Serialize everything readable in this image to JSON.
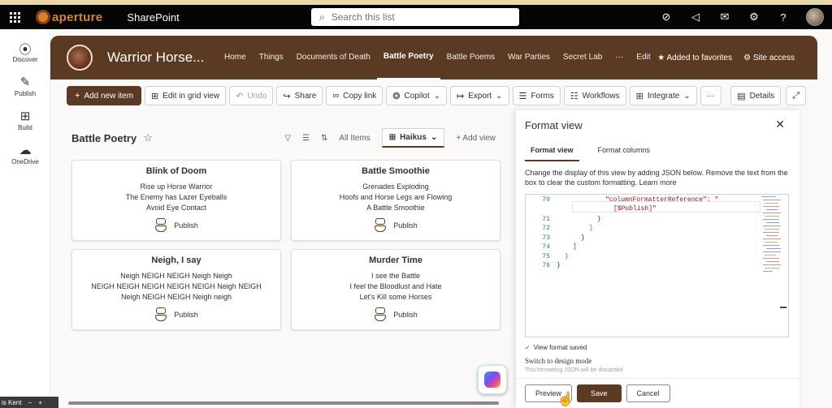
{
  "suite": {
    "brand": "aperture",
    "app_name": "SharePoint",
    "search_placeholder": "Search this list"
  },
  "appbar": {
    "items": [
      {
        "label": "Discover",
        "icon": "compass-icon"
      },
      {
        "label": "Publish",
        "icon": "pen-icon"
      },
      {
        "label": "Build",
        "icon": "grid-icon"
      },
      {
        "label": "OneDrive",
        "icon": "cloud-icon"
      }
    ]
  },
  "site": {
    "title": "Warrior Horse...",
    "nav": [
      "Home",
      "Things",
      "Documents of Death",
      "Battle Poetry",
      "Battle Poems",
      "War Parties",
      "Secret Lab",
      "···",
      "Edit"
    ],
    "active_nav": "Battle Poetry",
    "favorites_label": "Added to favorites",
    "site_access_label": "Site access"
  },
  "commands": {
    "add_new": "Add new item",
    "edit_grid": "Edit in grid view",
    "undo": "Undo",
    "share": "Share",
    "copy_link": "Copy link",
    "copilot": "Copilot",
    "export": "Export",
    "forms": "Forms",
    "workflows": "Workflows",
    "integrate": "Integrate",
    "more": "···",
    "details": "Details"
  },
  "list": {
    "title": "Battle Poetry",
    "view_all": "All Items",
    "current_view": "Haikus",
    "add_view": "Add view",
    "publish_label": "Publish",
    "tiles": [
      {
        "title": "Blink of Doom",
        "lines": [
          "Rise up Horse Warrior",
          "The Enemy has Lazer Eyeballs",
          "Avoid Eye Contact"
        ]
      },
      {
        "title": "Battle Smoothie",
        "lines": [
          "Grenades Exploding",
          "Hoofs and Horse Legs are Flowing",
          "A Battle Smoothie"
        ]
      },
      {
        "title": "Neigh, I say",
        "lines": [
          "Neigh NEIGH NEIGH Neigh Neigh",
          "NEIGH NEIGH NEIGH NEIGH NEIGH Neigh NEIGH",
          "Neigh NEIGH NEIGH Neigh neigh"
        ]
      },
      {
        "title": "Murder Time",
        "lines": [
          "I see the Battle",
          "I feel the Bloodlust and Hate",
          "Let's Kill some Horses"
        ]
      }
    ]
  },
  "pane": {
    "title": "Format view",
    "tabs": [
      "Format view",
      "Format columns"
    ],
    "description": "Change the display of this view by adding JSON below. Remove the text from the box to clear the custom formatting.",
    "learn_more": "Learn more",
    "code": [
      {
        "n": "70",
        "text": "\"columnFormatterReference\": \""
      },
      {
        "n": "",
        "text": "[$Publish]\""
      },
      {
        "n": "71",
        "text": "}"
      },
      {
        "n": "72",
        "text": "]"
      },
      {
        "n": "73",
        "text": "}"
      },
      {
        "n": "74",
        "text": "]"
      },
      {
        "n": "75",
        "text": "}"
      },
      {
        "n": "76",
        "text": "}"
      }
    ],
    "saved_text": "View format saved",
    "design_mode": "Switch to design mode",
    "design_note": "This formatting JSON will be discarded",
    "preview": "Preview",
    "save": "Save",
    "cancel": "Cancel"
  },
  "taskbar_text": "is Kent"
}
